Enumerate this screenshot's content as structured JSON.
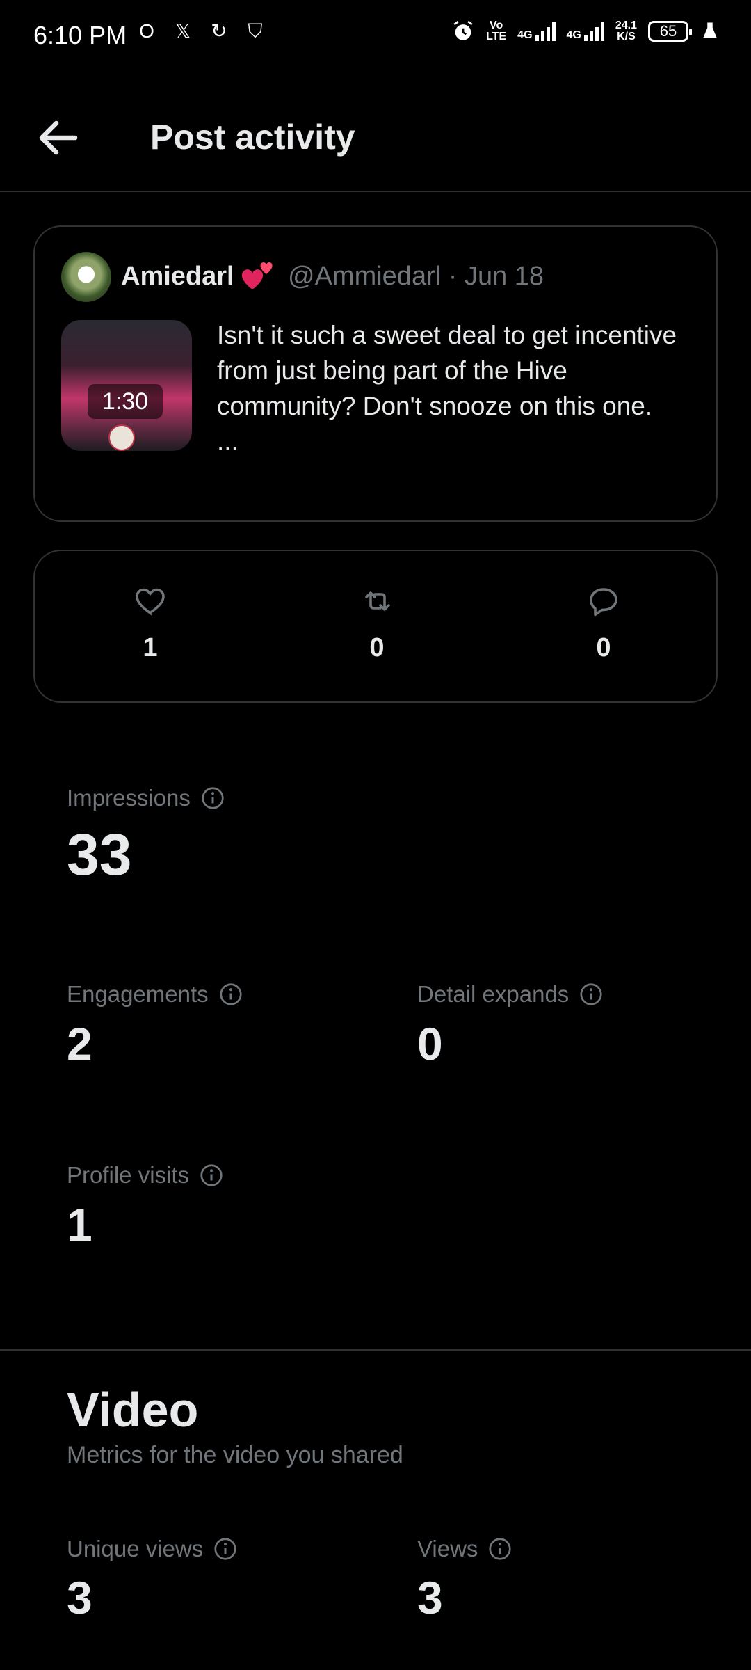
{
  "status_bar": {
    "time": "6:10 PM",
    "left_icons": [
      "opera-icon",
      "x-icon",
      "sync-icon",
      "shield-icon"
    ],
    "volte": "Vo\nLTE",
    "network1": "4G",
    "network2": "4G",
    "speed_value": "24.1",
    "speed_unit": "K/S",
    "battery": "65"
  },
  "header": {
    "title": "Post activity"
  },
  "tweet": {
    "author_name": "Amiedarl",
    "handle_date": "@Ammiedarl · Jun 18",
    "video_duration": "1:30",
    "text": "Isn't it such a sweet deal to get incentive from just being part of the Hive community? Don't snooze on this one.\n..."
  },
  "counts": {
    "likes": "1",
    "reposts": "0",
    "replies": "0"
  },
  "metrics": {
    "impressions_label": "Impressions",
    "impressions_value": "33",
    "engagements_label": "Engagements",
    "engagements_value": "2",
    "detail_expands_label": "Detail expands",
    "detail_expands_value": "0",
    "profile_visits_label": "Profile visits",
    "profile_visits_value": "1"
  },
  "video_section": {
    "title": "Video",
    "subtitle": "Metrics for the video you shared",
    "unique_views_label": "Unique views",
    "unique_views_value": "3",
    "views_label": "Views",
    "views_value": "3"
  },
  "colors": {
    "background": "#000000",
    "text_primary": "#e7e9ea",
    "text_secondary": "#71767b",
    "border": "#2f3336",
    "heart_accent": "#e0245e"
  }
}
